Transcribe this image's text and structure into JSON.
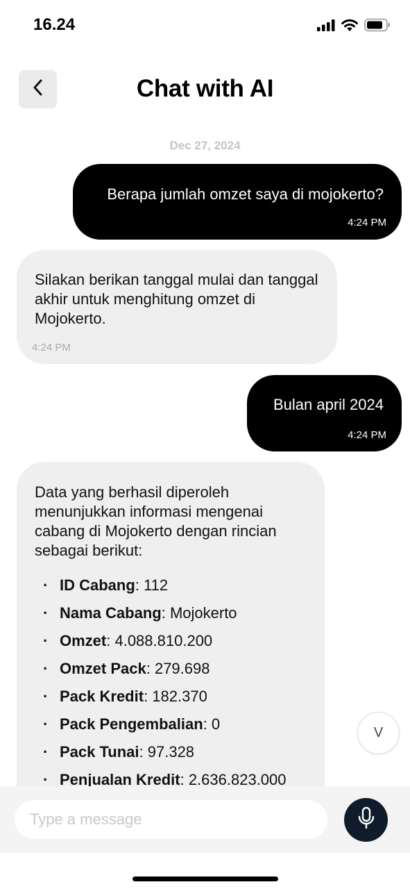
{
  "status_bar": {
    "time": "16.24"
  },
  "header": {
    "title": "Chat with AI"
  },
  "chat": {
    "date": "Dec 27, 2024",
    "messages": [
      {
        "sender": "user",
        "text": "Berapa jumlah omzet saya di mojokerto?",
        "time": "4:24 PM"
      },
      {
        "sender": "ai",
        "text": "Silakan berikan tanggal mulai dan tanggal akhir untuk menghitung omzet di Mojokerto.",
        "time": "4:24 PM"
      },
      {
        "sender": "user",
        "text": "Bulan april 2024",
        "time": "4:24 PM"
      },
      {
        "sender": "ai",
        "text": "Data yang berhasil diperoleh menunjukkan informasi mengenai cabang di Mojokerto dengan rincian sebagai berikut:",
        "items": [
          {
            "label": "ID Cabang",
            "value": ": 112"
          },
          {
            "label": "Nama Cabang",
            "value": ": Mojokerto"
          },
          {
            "label": "Omzet",
            "value": ": 4.088.810.200"
          },
          {
            "label": "Omzet Pack",
            "value": ": 279.698"
          },
          {
            "label": "Pack Kredit",
            "value": ": 182.370"
          },
          {
            "label": "Pack Pengembalian",
            "value": ": 0"
          },
          {
            "label": "Pack Tunai",
            "value": ": 97.328"
          },
          {
            "label": "Penjualan Kredit",
            "value": ": 2.636.823.000"
          }
        ]
      }
    ]
  },
  "scroll_button": {
    "label": "V"
  },
  "input": {
    "placeholder": "Type a message"
  },
  "colors": {
    "user_bubble": "#000000",
    "ai_bubble": "#efefef",
    "mic_button": "#101c2b"
  },
  "icons": [
    "signal-icon",
    "wifi-icon",
    "battery-icon",
    "back-chevron-icon",
    "mic-icon"
  ]
}
